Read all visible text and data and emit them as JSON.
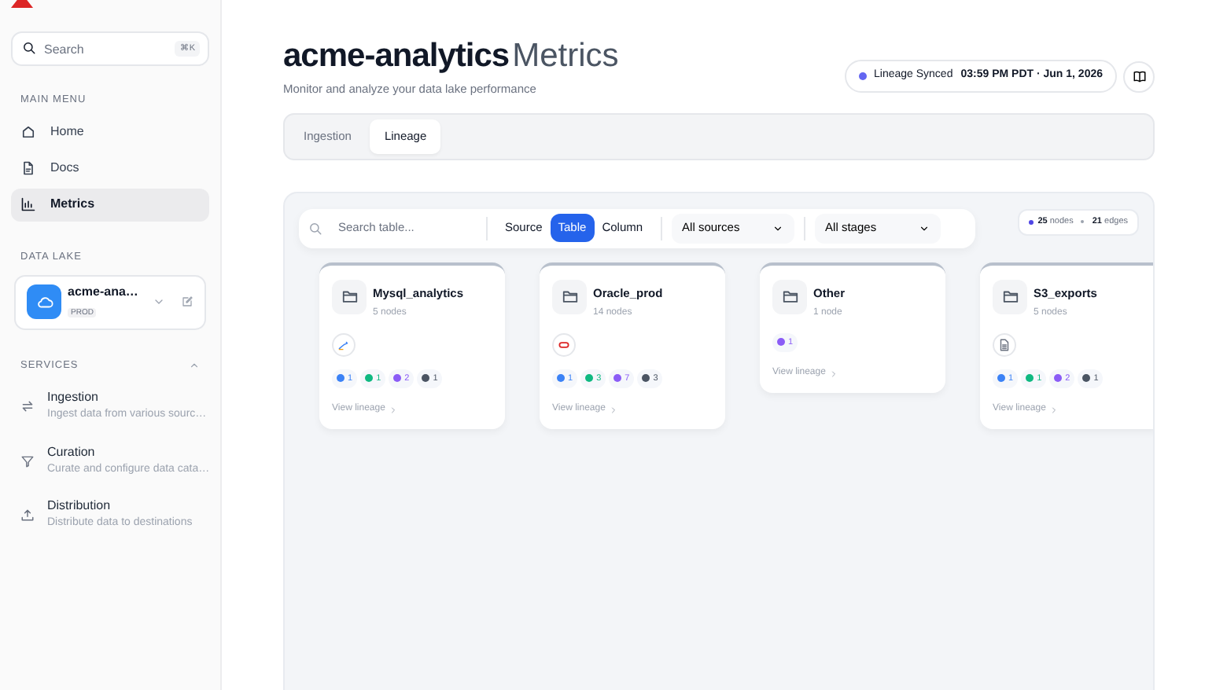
{
  "sidebar": {
    "search": {
      "placeholder": "Search",
      "shortcut": "⌘K"
    },
    "main_menu": {
      "heading": "MAIN MENU",
      "items": [
        {
          "label": "Home",
          "selected": false
        },
        {
          "label": "Docs",
          "selected": false
        },
        {
          "label": "Metrics",
          "selected": true
        }
      ]
    },
    "data_lake": {
      "heading": "DATA LAKE",
      "name": "acme-ana…",
      "badge": "PROD"
    },
    "services": {
      "heading": "SERVICES",
      "expanded": true,
      "items": [
        {
          "title": "Ingestion",
          "subtitle": "Ingest data from various sourc…"
        },
        {
          "title": "Curation",
          "subtitle": "Curate and configure data cata…"
        },
        {
          "title": "Distribution",
          "subtitle": "Distribute data to destinations"
        }
      ]
    }
  },
  "header": {
    "title": "acme-analytics",
    "title_suffix": "Metrics",
    "subtitle": "Monitor and analyze your data lake performance",
    "sync": {
      "label": "Lineage Synced",
      "time": "03:59 PM PDT · Jun 1, 2026",
      "color": "#6366f1"
    }
  },
  "tabs": [
    {
      "label": "Ingestion",
      "selected": false
    },
    {
      "label": "Lineage",
      "selected": true
    }
  ],
  "toolbar": {
    "search_placeholder": "Search table...",
    "levels": [
      {
        "label": "Source",
        "selected": false
      },
      {
        "label": "Table",
        "selected": true
      },
      {
        "label": "Column",
        "selected": false
      }
    ],
    "dropdowns": [
      "All sources",
      "All stages"
    ]
  },
  "stats": {
    "nodes": "25",
    "nodes_label": "nodes",
    "edges": "21",
    "edges_label": "edges"
  },
  "groups": [
    {
      "name": "Mysql_analytics",
      "count": "5 nodes",
      "kind": "database",
      "pills": [
        {
          "value": "1",
          "color": "#3b82f6"
        },
        {
          "value": "1",
          "color": "#10b981"
        },
        {
          "value": "2",
          "color": "#8b5cf6"
        },
        {
          "value": "1",
          "color": "#4b5563"
        }
      ],
      "link": "View lineage"
    },
    {
      "name": "Oracle_prod",
      "count": "14 nodes",
      "kind": "ring",
      "pills": [
        {
          "value": "1",
          "color": "#3b82f6"
        },
        {
          "value": "3",
          "color": "#10b981"
        },
        {
          "value": "7",
          "color": "#8b5cf6"
        },
        {
          "value": "3",
          "color": "#4b5563"
        }
      ],
      "link": "View lineage"
    },
    {
      "name": "Other",
      "count": "1 node",
      "kind": "plain",
      "pills": [
        {
          "value": "1",
          "color": "#8b5cf6"
        }
      ],
      "link": "View lineage"
    },
    {
      "name": "S3_exports",
      "count": "5 nodes",
      "kind": "file",
      "pills": [
        {
          "value": "1",
          "color": "#3b82f6"
        },
        {
          "value": "1",
          "color": "#10b981"
        },
        {
          "value": "2",
          "color": "#8b5cf6"
        },
        {
          "value": "1",
          "color": "#4b5563"
        }
      ],
      "link": "View lineage"
    }
  ]
}
